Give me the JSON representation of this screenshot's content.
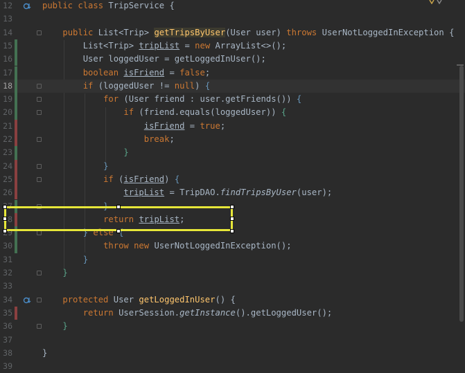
{
  "editor": {
    "lines": [
      {
        "n": "12",
        "segs": [
          [
            "kw",
            "public class "
          ],
          [
            "",
            "TripService "
          ],
          [
            "br",
            "{"
          ]
        ]
      },
      {
        "n": "13",
        "segs": []
      },
      {
        "n": "14",
        "segs": [
          [
            "",
            "    "
          ],
          [
            "kw",
            "public "
          ],
          [
            "",
            "List<Trip> "
          ],
          [
            "fn-hl",
            "getTripsByUser"
          ],
          [
            "",
            "(User user) "
          ],
          [
            "kw",
            "throws "
          ],
          [
            "",
            "UserNotLoggedInException "
          ],
          [
            "br",
            "{"
          ]
        ]
      },
      {
        "n": "15",
        "segs": [
          [
            "",
            "        List<Trip> "
          ],
          [
            "var",
            "tripList"
          ],
          [
            "",
            " = "
          ],
          [
            "kw",
            "new "
          ],
          [
            "",
            "ArrayList<>();"
          ]
        ]
      },
      {
        "n": "16",
        "segs": [
          [
            "",
            "        User loggedUser = getLoggedInUser();"
          ]
        ]
      },
      {
        "n": "17",
        "segs": [
          [
            "",
            "        "
          ],
          [
            "kw",
            "boolean "
          ],
          [
            "var",
            "isFriend"
          ],
          [
            "",
            " = "
          ],
          [
            "kw",
            "false"
          ],
          [
            "",
            ";"
          ]
        ]
      },
      {
        "n": "18",
        "segs": [
          [
            "",
            "        "
          ],
          [
            "kw",
            "if "
          ],
          [
            "",
            "(loggedUser != "
          ],
          [
            "kw",
            "null"
          ],
          [
            "",
            ") "
          ],
          [
            "br-b",
            "{"
          ]
        ]
      },
      {
        "n": "19",
        "segs": [
          [
            "",
            "            "
          ],
          [
            "kw",
            "for "
          ],
          [
            "",
            "(User friend : user.getFriends()) "
          ],
          [
            "br-b",
            "{"
          ]
        ]
      },
      {
        "n": "20",
        "segs": [
          [
            "",
            "                "
          ],
          [
            "kw",
            "if "
          ],
          [
            "",
            "(friend.equals(loggedUser)) "
          ],
          [
            "br-t",
            "{"
          ]
        ]
      },
      {
        "n": "21",
        "segs": [
          [
            "",
            "                    "
          ],
          [
            "var",
            "isFriend"
          ],
          [
            "",
            " = "
          ],
          [
            "kw",
            "true"
          ],
          [
            "",
            ";"
          ]
        ]
      },
      {
        "n": "22",
        "segs": [
          [
            "",
            "                    "
          ],
          [
            "kw",
            "break"
          ],
          [
            "",
            ";"
          ]
        ]
      },
      {
        "n": "23",
        "segs": [
          [
            "",
            "                "
          ],
          [
            "br-t",
            "}"
          ]
        ]
      },
      {
        "n": "24",
        "segs": [
          [
            "",
            "            "
          ],
          [
            "br-b",
            "}"
          ]
        ]
      },
      {
        "n": "25",
        "segs": [
          [
            "",
            "            "
          ],
          [
            "kw",
            "if "
          ],
          [
            "",
            "("
          ],
          [
            "var",
            "isFriend"
          ],
          [
            "",
            ") "
          ],
          [
            "br-b",
            "{"
          ]
        ]
      },
      {
        "n": "26",
        "segs": [
          [
            "",
            "                "
          ],
          [
            "var",
            "tripList"
          ],
          [
            "",
            " = TripDAO."
          ],
          [
            "it",
            "findTripsByUser"
          ],
          [
            "",
            "(user);"
          ]
        ]
      },
      {
        "n": "27",
        "segs": [
          [
            "",
            "            "
          ],
          [
            "br-b",
            "}"
          ]
        ]
      },
      {
        "n": "28",
        "segs": [
          [
            "",
            "            "
          ],
          [
            "kw",
            "return "
          ],
          [
            "var",
            "tripList"
          ],
          [
            "",
            ";"
          ]
        ]
      },
      {
        "n": "29",
        "segs": [
          [
            "",
            "        "
          ],
          [
            "br-b",
            "} "
          ],
          [
            "kw",
            "else "
          ],
          [
            "br-b",
            "{"
          ]
        ]
      },
      {
        "n": "30",
        "segs": [
          [
            "",
            "            "
          ],
          [
            "kw",
            "throw new "
          ],
          [
            "",
            "UserNotLoggedInException();"
          ]
        ]
      },
      {
        "n": "31",
        "segs": [
          [
            "",
            "        "
          ],
          [
            "br-b",
            "}"
          ]
        ]
      },
      {
        "n": "32",
        "segs": [
          [
            "",
            "    "
          ],
          [
            "br-t",
            "}"
          ]
        ]
      },
      {
        "n": "33",
        "segs": []
      },
      {
        "n": "34",
        "segs": [
          [
            "",
            "    "
          ],
          [
            "kw",
            "protected "
          ],
          [
            "",
            "User "
          ],
          [
            "fn",
            "getLoggedInUser"
          ],
          [
            "",
            "() "
          ],
          [
            "br",
            "{"
          ]
        ]
      },
      {
        "n": "35",
        "segs": [
          [
            "",
            "        "
          ],
          [
            "kw",
            "return "
          ],
          [
            "",
            "UserSession."
          ],
          [
            "it",
            "getInstance"
          ],
          [
            "",
            "().getLoggedUser();"
          ]
        ]
      },
      {
        "n": "36",
        "segs": [
          [
            "",
            "    "
          ],
          [
            "br-t",
            "}"
          ]
        ]
      },
      {
        "n": "37",
        "segs": []
      },
      {
        "n": "38",
        "segs": [
          [
            "br",
            "}"
          ]
        ]
      },
      {
        "n": "39",
        "segs": []
      }
    ],
    "current_line": "18",
    "colors": {
      "background": "#2b2b2b",
      "keyword": "#cc7832",
      "method": "#ffc66d",
      "text": "#a9b7c6",
      "selection_box": "#e6e639"
    }
  }
}
